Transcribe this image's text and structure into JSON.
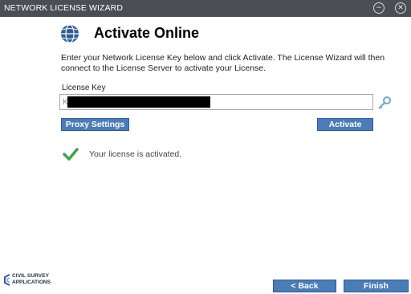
{
  "window": {
    "title": "NETWORK LICENSE WIZARD",
    "minimize_glyph": "−",
    "close_glyph": "✕"
  },
  "page": {
    "heading": "Activate Online",
    "description": "Enter your Network License Key below and click Activate. The License Wizard will then connect to the License Server to activate your License.",
    "license_key_label": "License Key",
    "license_key_value": "K                                                             D",
    "license_key_redacted": true
  },
  "buttons": {
    "proxy_settings": "Proxy Settings",
    "activate": "Activate",
    "back": "< Back",
    "finish": "Finish"
  },
  "status": {
    "message": "Your license is activated.",
    "icon": "checkmark-icon",
    "color": "#3aa54a"
  },
  "branding": {
    "line1": "CIVIL SURVEY",
    "line2": "APPLICATIONS"
  },
  "colors": {
    "titlebar": "#4b4f55",
    "button": "#4a7cb8",
    "accent": "#2d5d95"
  },
  "icons": [
    "globe-icon",
    "key-icon",
    "checkmark-icon",
    "minimize-icon",
    "close-icon"
  ]
}
